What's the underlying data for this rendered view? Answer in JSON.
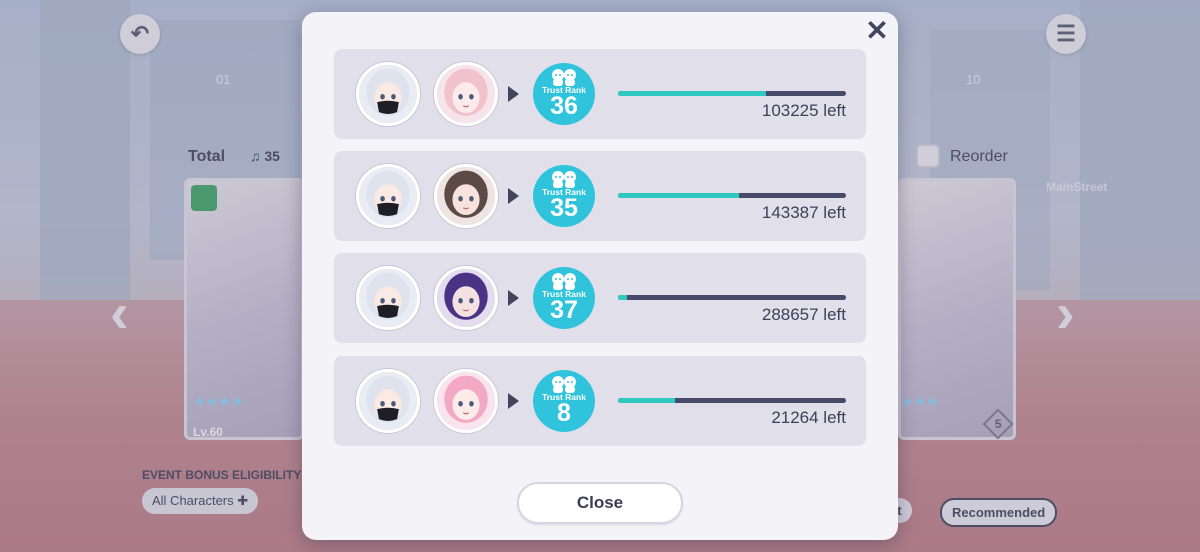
{
  "background": {
    "tab_left_num": "01",
    "tab_right_num": "10",
    "total_label": "Total",
    "total_value": "35",
    "reorder_label": "Reorder",
    "card_level": "Lv.60",
    "event_bonus_label": "EVENT BONUS ELIGIBILITY",
    "all_characters_label": "All Characters",
    "recommended_label": "Recommended",
    "partial_pill_label": "et",
    "card_right_rank": "5",
    "street_sign": "MainStreet"
  },
  "modal": {
    "close_x_label": "✕",
    "close_button_label": "Close",
    "rank_label": "Trust Rank",
    "accent_color": "#2fc4dc",
    "bar_fill_color": "#2fc9c1",
    "bar_track_color": "#474a68",
    "rows": [
      {
        "left_avatar": "silver-hair-mask-character",
        "right_avatar": "pink-hair-character",
        "rank": "36",
        "progress": 0.65,
        "remaining": "103225 left"
      },
      {
        "left_avatar": "silver-hair-mask-character",
        "right_avatar": "brown-hair-character",
        "rank": "35",
        "progress": 0.53,
        "remaining": "143387 left"
      },
      {
        "left_avatar": "silver-hair-mask-character",
        "right_avatar": "purple-hair-character",
        "rank": "37",
        "progress": 0.04,
        "remaining": "288657 left"
      },
      {
        "left_avatar": "silver-hair-mask-character",
        "right_avatar": "pink-headphones-character",
        "rank": "8",
        "progress": 0.25,
        "remaining": "21264 left"
      }
    ]
  }
}
